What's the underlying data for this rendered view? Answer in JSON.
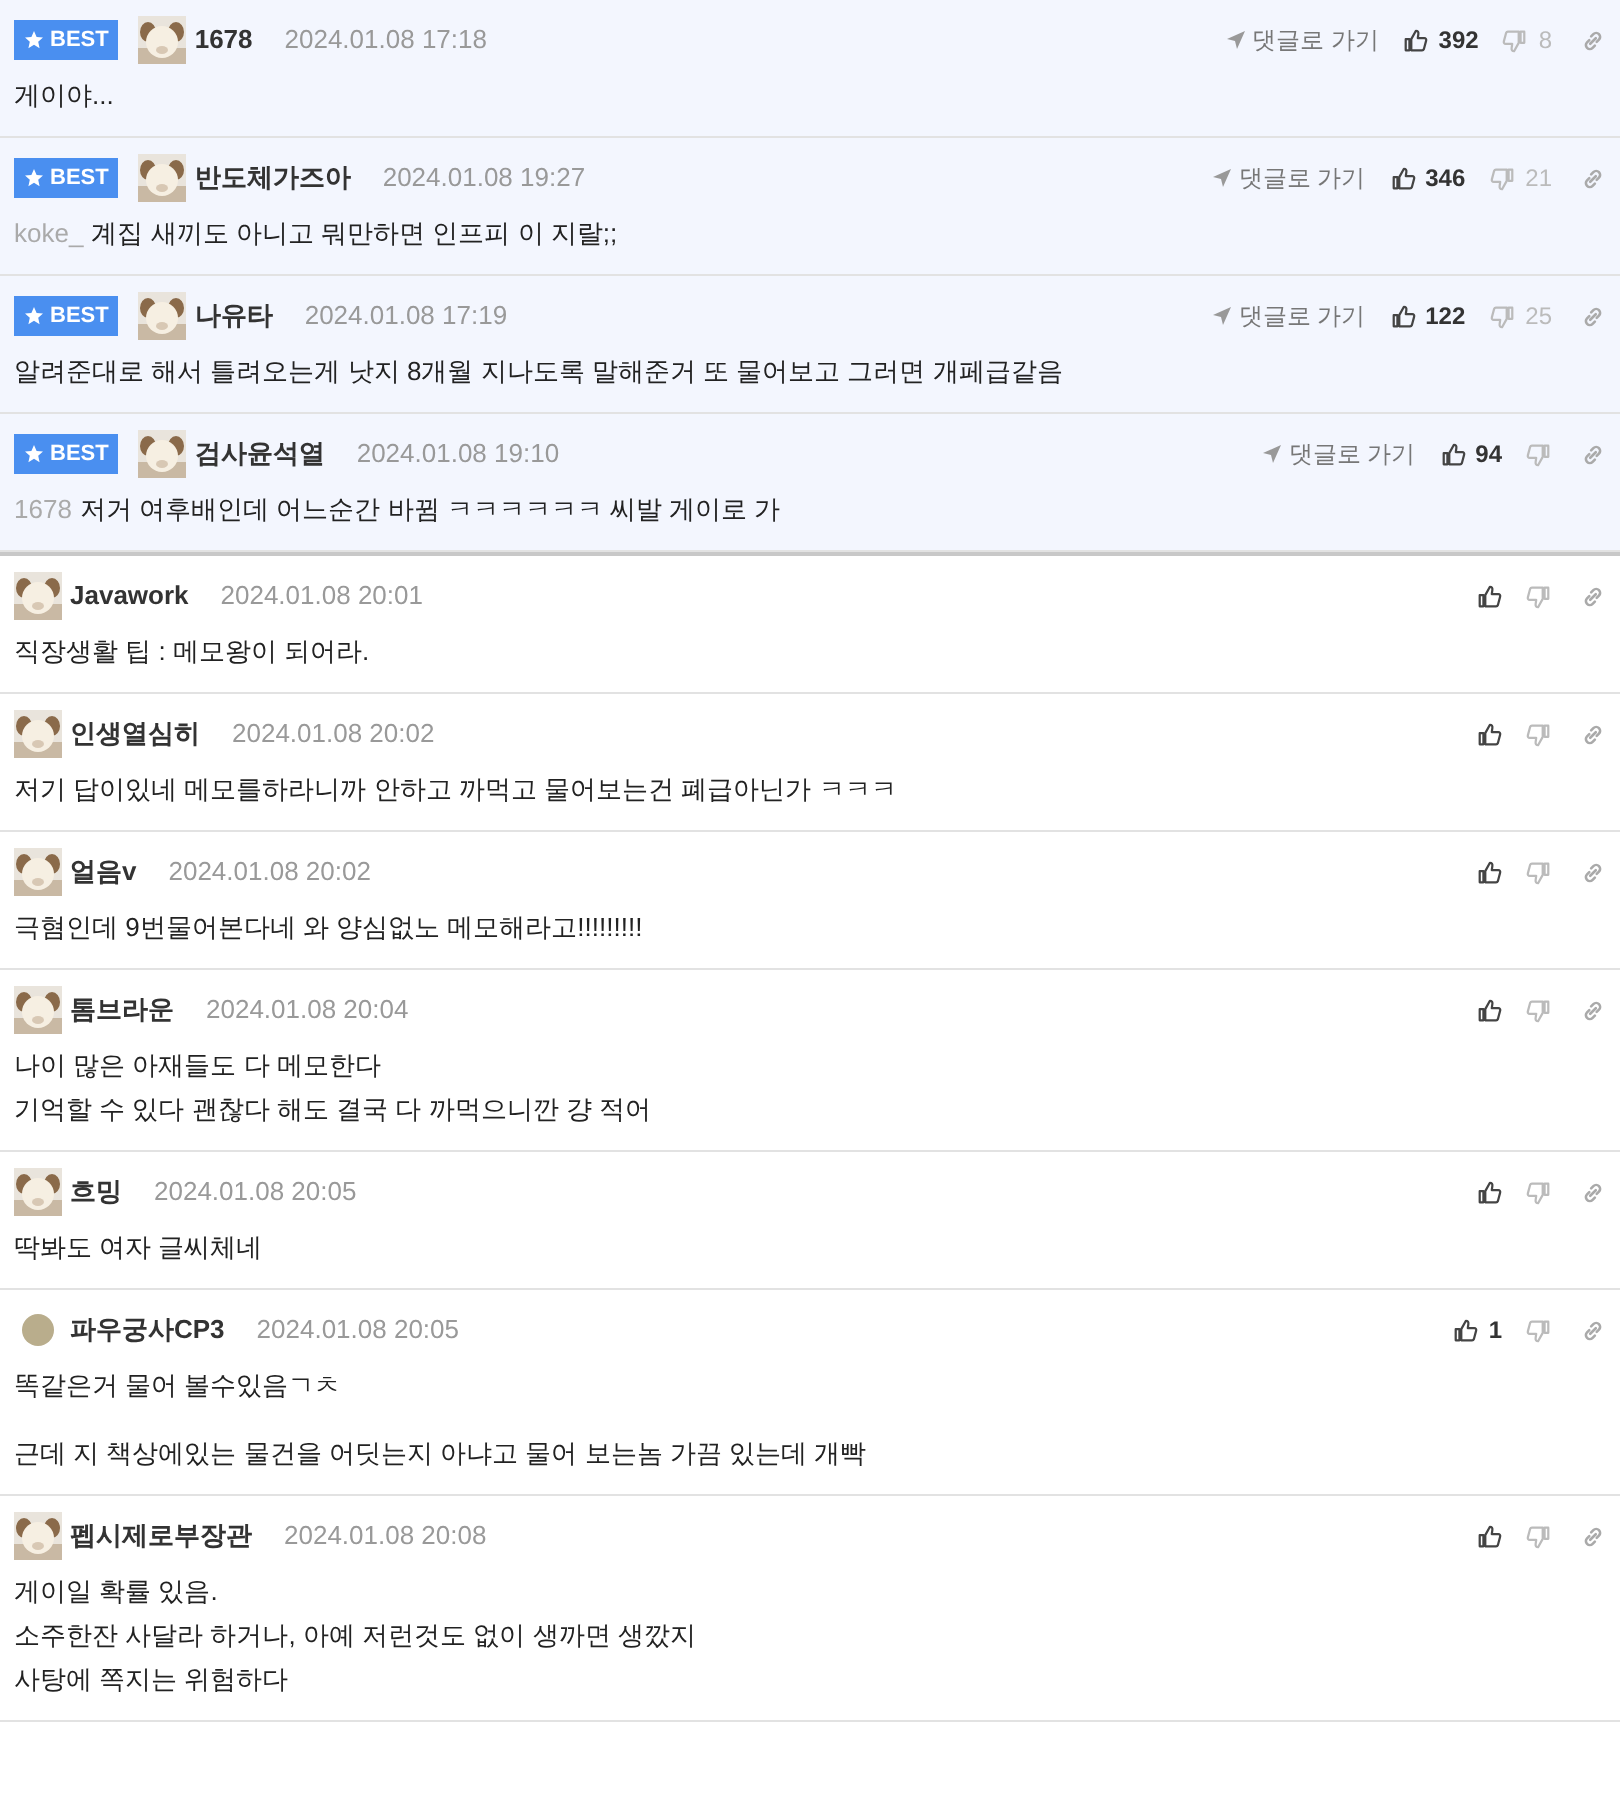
{
  "best_comments": [
    {
      "badge": "BEST",
      "avatar": {
        "kind": "picture"
      },
      "name": "1678",
      "date": "2024.01.08 17:18",
      "reply_link": "댓글로 가기",
      "up": "392",
      "down": "8",
      "paragraphs": [
        [
          "게이야..."
        ]
      ]
    },
    {
      "badge": "BEST",
      "avatar": {
        "kind": "picture"
      },
      "name": "반도체가즈아",
      "date": "2024.01.08 19:27",
      "reply_link": "댓글로 가기",
      "up": "346",
      "down": "21",
      "mention": "koke_",
      "paragraphs": [
        [
          "계집 새끼도 아니고 뭐만하면 인프피 이 지랄;;"
        ]
      ]
    },
    {
      "badge": "BEST",
      "avatar": {
        "kind": "picture"
      },
      "name": "나유타",
      "date": "2024.01.08 17:19",
      "reply_link": "댓글로 가기",
      "up": "122",
      "down": "25",
      "paragraphs": [
        [
          "알려준대로 해서 틀려오는게 낫지 8개월 지나도록 말해준거 또 물어보고 그러면 개페급같음"
        ]
      ]
    },
    {
      "badge": "BEST",
      "avatar": {
        "kind": "picture"
      },
      "name": "검사윤석열",
      "date": "2024.01.08 19:10",
      "reply_link": "댓글로 가기",
      "up": "94",
      "mention": "1678",
      "paragraphs": [
        [
          "저거 여후배인데 어느순간 바뀜 ㅋㅋㅋㅋㅋㅋ 씨발 게이로 가"
        ]
      ]
    }
  ],
  "comments": [
    {
      "avatar": {
        "kind": "picture"
      },
      "name": "Javawork",
      "date": "2024.01.08 20:01",
      "paragraphs": [
        [
          "직장생활 팁 : 메모왕이 되어라."
        ]
      ]
    },
    {
      "avatar": {
        "kind": "picture"
      },
      "name": "인생열심히",
      "date": "2024.01.08 20:02",
      "paragraphs": [
        [
          "저기 답이있네 메모를하라니까 안하고 까먹고 물어보는건 폐급아닌가 ㅋㅋㅋ"
        ]
      ]
    },
    {
      "avatar": {
        "kind": "picture"
      },
      "name": "얼음v",
      "date": "2024.01.08 20:02",
      "paragraphs": [
        [
          "극혐인데 9번물어본다네 와 양심없노 메모해라고!!!!!!!!!"
        ]
      ]
    },
    {
      "avatar": {
        "kind": "picture"
      },
      "name": "톰브라운",
      "date": "2024.01.08 20:04",
      "paragraphs": [
        [
          "나이 많은 아재들도 다 메모한다",
          "기억할 수 있다 괜찮다 해도 결국 다 까먹으니깐 걍 적어"
        ]
      ]
    },
    {
      "avatar": {
        "kind": "picture"
      },
      "name": "흐밍",
      "date": "2024.01.08 20:05",
      "paragraphs": [
        [
          "딱봐도 여자 글씨체네"
        ]
      ]
    },
    {
      "avatar": {
        "kind": "dot",
        "color": "#b9ad8c"
      },
      "name": "파우궁사CP3",
      "date": "2024.01.08 20:05",
      "up": "1",
      "paragraphs": [
        [
          "똑같은거 물어 볼수있음ㄱㅊ"
        ],
        [
          "근데 지 책상에있는 물건을 어딧는지 아냐고 물어 보는놈 가끔 있는데 개빡"
        ]
      ]
    },
    {
      "avatar": {
        "kind": "picture"
      },
      "name": "펩시제로부장관",
      "date": "2024.01.08 20:08",
      "paragraphs": [
        [
          "게이일 확률 있음.",
          "소주한잔 사달라 하거나, 아예 저런것도 없이 생까면 생깠지",
          "사탕에 쪽지는 위험하다"
        ]
      ]
    }
  ]
}
